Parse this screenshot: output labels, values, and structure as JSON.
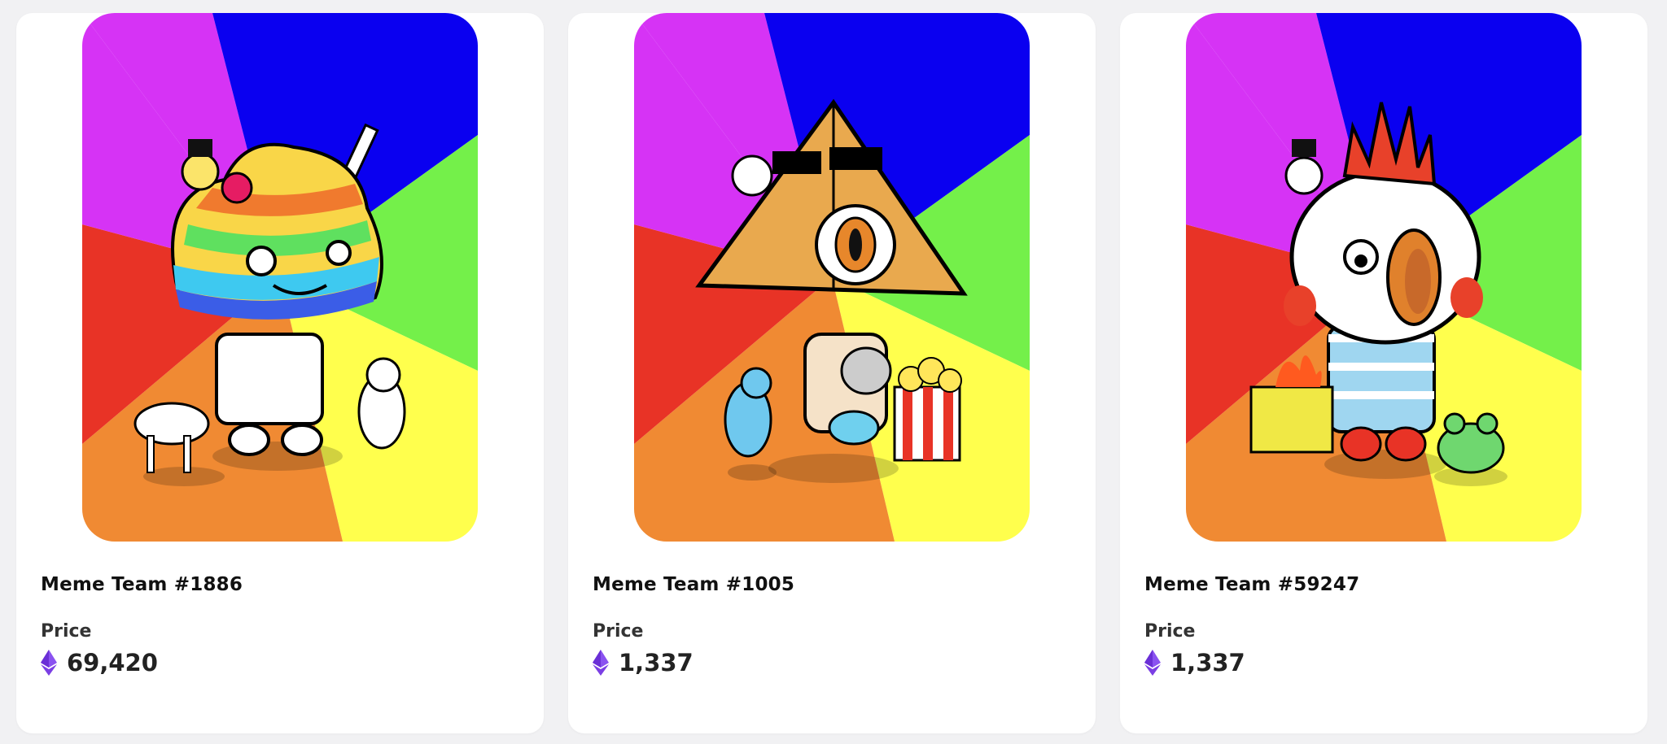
{
  "cards": [
    {
      "title": "Meme Team #1886",
      "price_label": "Price",
      "price_value": "69,420",
      "currency_icon": "ethereum-icon",
      "artwork": "rainbow-poop-character"
    },
    {
      "title": "Meme Team #1005",
      "price_label": "Price",
      "price_value": "1,337",
      "currency_icon": "ethereum-icon",
      "artwork": "pyramid-eye-character"
    },
    {
      "title": "Meme Team #59247",
      "price_label": "Price",
      "price_value": "1,337",
      "currency_icon": "ethereum-icon",
      "artwork": "chicken-character"
    }
  ],
  "colors": {
    "ray_purple": "#d633f5",
    "ray_blue": "#0a00f0",
    "ray_green": "#74f04a",
    "ray_yellow": "#ffff4d",
    "ray_orange": "#f08a33",
    "ray_red": "#e83326",
    "eth_purple": "#7b3fe4"
  }
}
